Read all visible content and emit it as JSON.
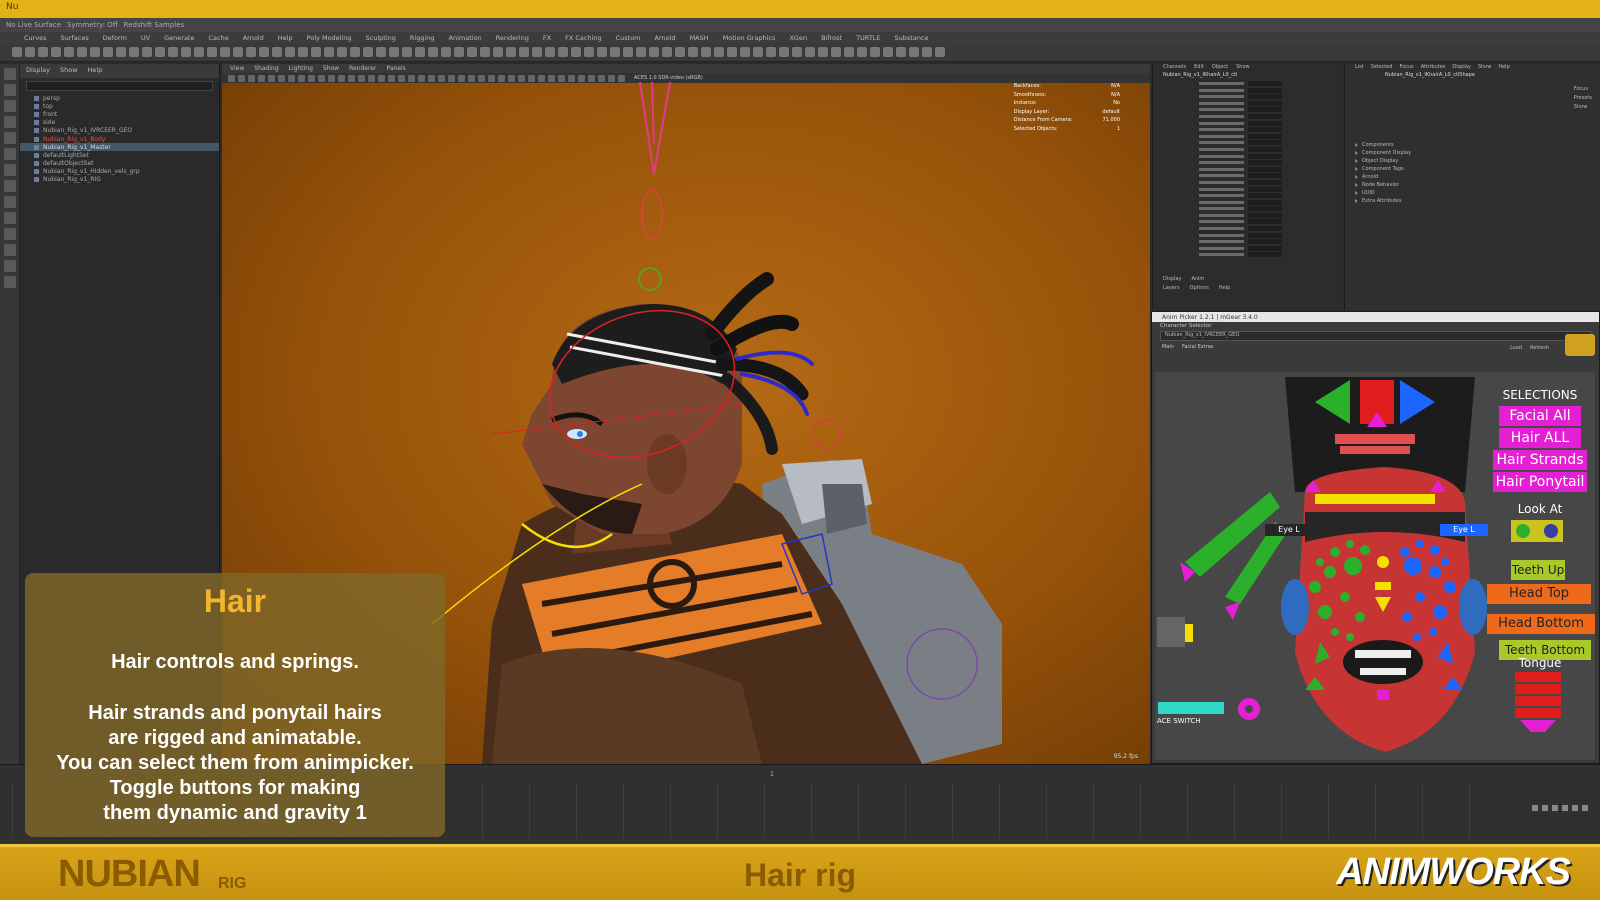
{
  "window": {
    "title": "Nu"
  },
  "statusline": {
    "items": [
      "No Live Surface",
      "Symmetry: Off",
      "Redshift Samples"
    ]
  },
  "menubar": {
    "items": [
      "Curves",
      "Surfaces",
      "Deform",
      "UV",
      "Generate",
      "Cache",
      "Arnold",
      "Help",
      "Poly Modeling",
      "Sculpting",
      "Rigging",
      "Animation",
      "Rendering",
      "FX",
      "FX Caching",
      "Custom",
      "Arnold",
      "MASH",
      "Motion Graphics",
      "XGen",
      "Bifrost",
      "TURTLE",
      "Substance"
    ]
  },
  "outliner": {
    "menu": [
      "Display",
      "Show",
      "Help"
    ],
    "rows": [
      {
        "label": "persp",
        "state": ""
      },
      {
        "label": "top",
        "state": ""
      },
      {
        "label": "front",
        "state": ""
      },
      {
        "label": "side",
        "state": ""
      },
      {
        "label": "Nubian_Rig_v1_IVRCEER_GEO",
        "state": ""
      },
      {
        "label": "Nubian_Rig_v1_Body",
        "state": "red"
      },
      {
        "label": "Nubian_Rig_v1_Master",
        "state": "sel"
      },
      {
        "label": "defaultLightSet",
        "state": ""
      },
      {
        "label": "defaultObjectSet",
        "state": ""
      },
      {
        "label": "Nubian_Rig_v1_Hidden_vels_grp",
        "state": ""
      },
      {
        "label": "Nubian_Rig_v1_RIG",
        "state": ""
      }
    ]
  },
  "viewport": {
    "menu": [
      "View",
      "Shading",
      "Lighting",
      "Show",
      "Renderer",
      "Panels"
    ],
    "colorspace": "ACES 1.0 SDR-video (sRGB)",
    "hud": [
      {
        "label": "Backfaces:",
        "value": "N/A"
      },
      {
        "label": "Smoothness:",
        "value": "N/A"
      },
      {
        "label": "Instance:",
        "value": "No"
      },
      {
        "label": "Display Layer:",
        "value": "default"
      },
      {
        "label": "Distance From Camera:",
        "value": "71.000"
      },
      {
        "label": "Selected Objects:",
        "value": "1"
      }
    ],
    "fps": "95.2 fps"
  },
  "channelbox": {
    "menu": [
      "Channels",
      "Edit",
      "Object",
      "Show"
    ],
    "node": "Nubian_Rig_v1_IKhairA_L0_ctl",
    "footer_menu": [
      "Display",
      "Anim"
    ],
    "footer_sub": [
      "Layers",
      "Options",
      "Help"
    ]
  },
  "attreditor": {
    "menu": [
      "List",
      "Selected",
      "Focus",
      "Attributes",
      "Display",
      "Show",
      "Help"
    ],
    "tab": "Nubian_Rig_v1_IKhairA_L0_ctlShape",
    "buttons": [
      "Focus",
      "Presets",
      "Show",
      "Hide"
    ],
    "sections": [
      "Components",
      "Component Display",
      "Object Display",
      "Component Tags",
      "Arnold",
      "Node Behavior",
      "UUID",
      "Extra Attributes"
    ]
  },
  "picker": {
    "title": "Anim Picker 1.2.1 | mGear 3.4.0",
    "char_label": "Character Selector",
    "char_value": "Nubian_Rig_v1_IVRCEER_GEO",
    "tabs": [
      "Main",
      "Facial Extras"
    ],
    "buttons": [
      "Load",
      "Refresh"
    ],
    "selections_label": "SELECTIONS",
    "sel_buttons": [
      {
        "label": "Facial All",
        "color": "#e520d4"
      },
      {
        "label": "Hair ALL",
        "color": "#e520d4"
      },
      {
        "label": "Hair Strands",
        "color": "#e520d4"
      },
      {
        "label": "Hair Ponytail",
        "color": "#e520d4"
      }
    ],
    "look_at_label": "Look At",
    "eye_l": "Eye L",
    "eye_r": "Eye L",
    "teeth_up": "Teeth Up",
    "head_top": "Head Top",
    "head_bottom": "Head Bottom",
    "teeth_bottom": "Teeth Bottom",
    "tongue": "Tongue",
    "face_switch": "ACE SWITCH",
    "colors": {
      "green": "#2bb02b",
      "orange": "#ee6a1a",
      "yellowgreen": "#a7c92a",
      "red": "#e01e1e",
      "yellow": "#f5e100",
      "blue": "#1c66ff"
    }
  },
  "timeline": {
    "current_frame": "1"
  },
  "overlay": {
    "title": "Hair",
    "subtitle": "Hair controls and springs.",
    "body": [
      "Hair strands and ponytail hairs",
      "are rigged and animatable.",
      "You can select them from animpicker.",
      "Toggle buttons for making",
      "them dynamic and gravity 1"
    ]
  },
  "branding": {
    "name": "NUBIAN",
    "suffix": "RIG",
    "topic": "Hair rig",
    "studio": "ANIMWORKS"
  }
}
